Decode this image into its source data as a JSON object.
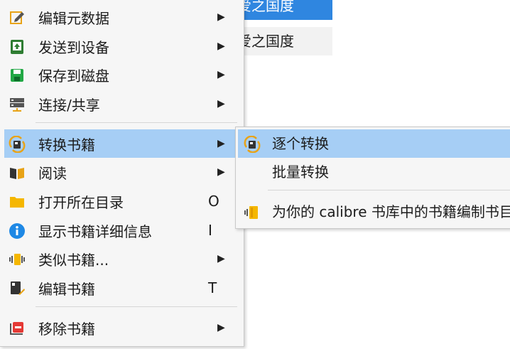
{
  "background_list": {
    "row_selected": "爱之国度",
    "row_next": "爱之国度"
  },
  "menu": {
    "items": [
      {
        "label": "编辑元数据",
        "icon": "edit-metadata-icon",
        "has_submenu": true
      },
      {
        "label": "发送到设备",
        "icon": "send-to-device-icon",
        "has_submenu": true
      },
      {
        "label": "保存到磁盘",
        "icon": "save-to-disk-icon",
        "has_submenu": true
      },
      {
        "label": "连接/共享",
        "icon": "connect-share-icon",
        "has_submenu": true
      },
      {
        "label": "转换书籍",
        "icon": "convert-books-icon",
        "has_submenu": true,
        "highlighted": true
      },
      {
        "label": "阅读",
        "icon": "read-book-icon",
        "has_submenu": true
      },
      {
        "label": "打开所在目录",
        "icon": "folder-icon",
        "shortcut": "O"
      },
      {
        "label": "显示书籍详细信息",
        "icon": "info-icon",
        "shortcut": "I"
      },
      {
        "label": "类似书籍...",
        "icon": "similar-books-icon",
        "has_submenu": true
      },
      {
        "label": "编辑书籍",
        "icon": "edit-book-icon",
        "shortcut": "T"
      },
      {
        "label": "移除书籍",
        "icon": "remove-books-icon",
        "has_submenu": true
      }
    ],
    "arrow_glyph": "▶"
  },
  "submenu": {
    "items": [
      {
        "label": "逐个转换",
        "icon": "convert-individually-icon",
        "highlighted": true
      },
      {
        "label": "批量转换",
        "icon": ""
      },
      {
        "label": "为你的 calibre 书库中的书籍编制书目",
        "icon": "catalog-icon"
      }
    ]
  },
  "colors": {
    "highlight": "#a6cef5",
    "selection_blue": "#2f86e0",
    "menu_bg": "#f6f6f6"
  }
}
